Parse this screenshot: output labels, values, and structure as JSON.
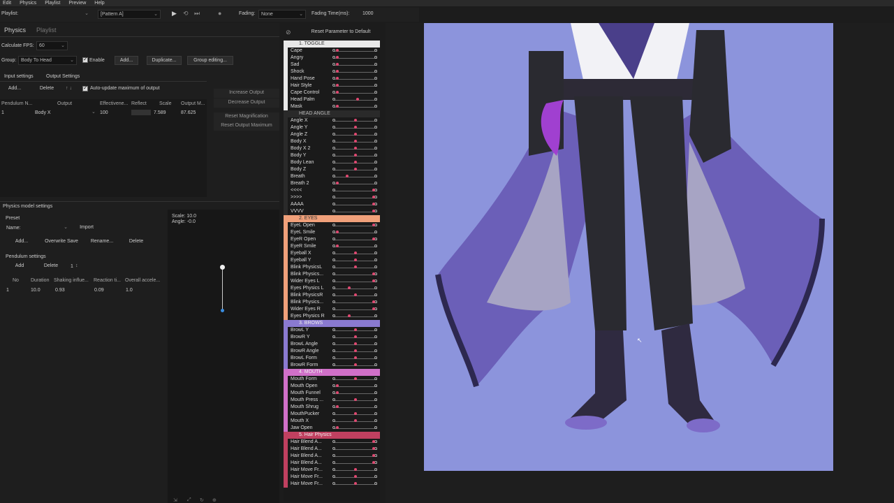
{
  "menu": [
    "Edit",
    "Physics",
    "Playlist",
    "Preview",
    "Help"
  ],
  "toolbar": {
    "playlist_label": "Playlist:",
    "pattern_value": "[Pattern A]",
    "fading_label": "Fading:",
    "fading_value": "None",
    "fading_time_label": "Fading Time(ms):",
    "fading_time_value": "1000"
  },
  "left_tabs": [
    "Physics",
    "Playlist"
  ],
  "physics": {
    "fps_label": "Calculate FPS:",
    "fps_value": "60",
    "group_label": "Group:",
    "group_value": "Body To Head",
    "enable_label": "Enable",
    "add": "Add...",
    "duplicate": "Duplicate...",
    "group_editing": "Group editing...",
    "subtabs": [
      "Input settings",
      "Output Settings"
    ],
    "out_add": "Add...",
    "out_delete": "Delete",
    "auto_update": "Auto-update maximum of output",
    "columns": [
      "Pendulum N...",
      "Output",
      "Effectivene...",
      "Reflect",
      "Scale",
      "Output M..."
    ],
    "row": [
      "1",
      "Body X",
      "100",
      "7.589",
      "87.625"
    ],
    "side_buttons": [
      "Increase Output",
      "Decrease Output",
      "Reset Magnification",
      "Reset Output Maximum"
    ]
  },
  "model_settings": {
    "title": "Physics model settings",
    "preset_label": "Preset",
    "name_label": "Name:",
    "import": "Import",
    "add": "Add...",
    "overwrite": "Overwrite Save",
    "rename": "Rename...",
    "delete": "Delete",
    "pendulum_label": "Pendulum settings",
    "p_add": "Add",
    "p_delete": "Delete",
    "p_count": "1",
    "columns": [
      "No",
      "Duration",
      "Shaking influe...",
      "Reaction ti...",
      "Overall accele..."
    ],
    "row": [
      "1",
      "10.0",
      "0.93",
      "0.09",
      "1.0"
    ],
    "scale_text": "Scale: 10.0",
    "angle_text": "Angle: -0.0"
  },
  "reset_button": "Reset Parameter to Default",
  "groups": [
    {
      "title": "1. TOGGLE",
      "color": "#e8e8e8",
      "text": "#333",
      "params": [
        {
          "name": "Cape",
          "k": 0.05
        },
        {
          "name": "Angry",
          "k": 0.05
        },
        {
          "name": "Sad",
          "k": 0.05
        },
        {
          "name": "Shock",
          "k": 0.05
        },
        {
          "name": "Hand Pose",
          "k": 0.05
        },
        {
          "name": "Hair Style",
          "k": 0.05
        },
        {
          "name": "Cape Control",
          "k": 0.05
        },
        {
          "name": "Head Palm",
          "k": 0.55
        },
        {
          "name": "Mask",
          "k": 0.05
        }
      ]
    },
    {
      "title": "HEAD ANGLE",
      "color": "#2a2a2a",
      "text": "#bbb",
      "params": [
        {
          "name": "Angle X",
          "k": 0.5
        },
        {
          "name": "Angle Y",
          "k": 0.5
        },
        {
          "name": "Angle Z",
          "k": 0.5
        },
        {
          "name": "Body X",
          "k": 0.5
        },
        {
          "name": "Body X 2",
          "k": 0.5
        },
        {
          "name": "Body Y",
          "k": 0.5
        },
        {
          "name": "Body Lean",
          "k": 0.5
        },
        {
          "name": "Body Z",
          "k": 0.5
        },
        {
          "name": "Breath",
          "k": 0.3
        },
        {
          "name": "Breath 2",
          "k": 0.05
        },
        {
          "name": "<<<<",
          "k": 0.95
        },
        {
          "name": ">>>>",
          "k": 0.95
        },
        {
          "name": "AAAA",
          "k": 0.95
        },
        {
          "name": "VVVV",
          "k": 0.95
        }
      ]
    },
    {
      "title": "2. EYES",
      "color": "#f0a07a",
      "text": "#333",
      "params": [
        {
          "name": "EyeL Open",
          "k": 0.95
        },
        {
          "name": "EyeL Smile",
          "k": 0.05
        },
        {
          "name": "EyeR Open",
          "k": 0.95
        },
        {
          "name": "EyeR Smile",
          "k": 0.05
        },
        {
          "name": "Eyeball X",
          "k": 0.5
        },
        {
          "name": "Eyeball Y",
          "k": 0.5
        },
        {
          "name": "Blink PhysicsL",
          "k": 0.5
        },
        {
          "name": "Blink Physics...",
          "k": 0.95
        },
        {
          "name": "Wider Eyes L",
          "k": 0.95
        },
        {
          "name": "Eyes Physics L",
          "k": 0.35
        },
        {
          "name": "Blink PhysicsR",
          "k": 0.5
        },
        {
          "name": "Blink Physics...",
          "k": 0.95
        },
        {
          "name": "Wider Eyes R",
          "k": 0.95
        },
        {
          "name": "Eyes Physics R",
          "k": 0.35
        }
      ]
    },
    {
      "title": "3. BROWS",
      "color": "#8a7ad0",
      "text": "#eee",
      "params": [
        {
          "name": "BrowL Y",
          "k": 0.5
        },
        {
          "name": "BrowR Y",
          "k": 0.5
        },
        {
          "name": "BrowL Angle",
          "k": 0.5
        },
        {
          "name": "BrowR Angle",
          "k": 0.5
        },
        {
          "name": "BrowL Form",
          "k": 0.5
        },
        {
          "name": "BrowR Form",
          "k": 0.5
        }
      ]
    },
    {
      "title": "4. MOUTH",
      "color": "#d070c8",
      "text": "#eee",
      "params": [
        {
          "name": "Mouth Form",
          "k": 0.5
        },
        {
          "name": "Mouth Open",
          "k": 0.05
        },
        {
          "name": "Mouth Funnel",
          "k": 0.05
        },
        {
          "name": "Mouth Press ...",
          "k": 0.5
        },
        {
          "name": "Mouth Shrug",
          "k": 0.05
        },
        {
          "name": "MouthPucker",
          "k": 0.5
        },
        {
          "name": "Mouth X",
          "k": 0.5
        },
        {
          "name": "Jaw Open",
          "k": 0.05
        }
      ]
    },
    {
      "title": "5. Hair Physics",
      "color": "#c04060",
      "text": "#eee",
      "params": [
        {
          "name": "Hair Blend A...",
          "k": 0.95
        },
        {
          "name": "Hair Blend A...",
          "k": 0.95
        },
        {
          "name": "Hair Blend A...",
          "k": 0.95
        },
        {
          "name": "Hair Blend A...",
          "k": 0.95
        },
        {
          "name": "Hair Move Fr...",
          "k": 0.5
        },
        {
          "name": "Hair Move Fr...",
          "k": 0.5
        },
        {
          "name": "Hair Move Fr...",
          "k": 0.5
        }
      ]
    }
  ],
  "colors": {
    "canvas_bg": "#8c94dc",
    "accent": "#e04870"
  }
}
